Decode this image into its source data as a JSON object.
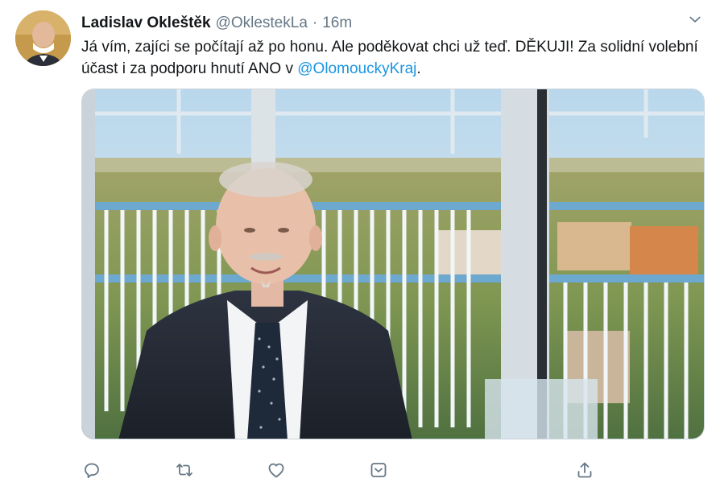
{
  "tweet": {
    "display_name": "Ladislav Okleštěk",
    "handle": "@OklestekLa",
    "separator": "·",
    "time": "16m",
    "text_before_mention": "Já vím, zajíci se počítají až po honu. Ale poděkovat chci už teď. DĚKUJI! Za solidní volební účast i za podporu hnutí ANO v ",
    "mention": "@OlomouckyKraj",
    "text_after_mention": "."
  },
  "colors": {
    "text": "#14171a",
    "secondary": "#657786",
    "link": "#1b95e0",
    "icon": "#657786",
    "border": "#ccd6dd"
  },
  "icons": {
    "caret": "chevron-down-icon",
    "reply": "reply-icon",
    "retweet": "retweet-icon",
    "like": "like-icon",
    "save": "save-icon",
    "share": "share-icon"
  }
}
